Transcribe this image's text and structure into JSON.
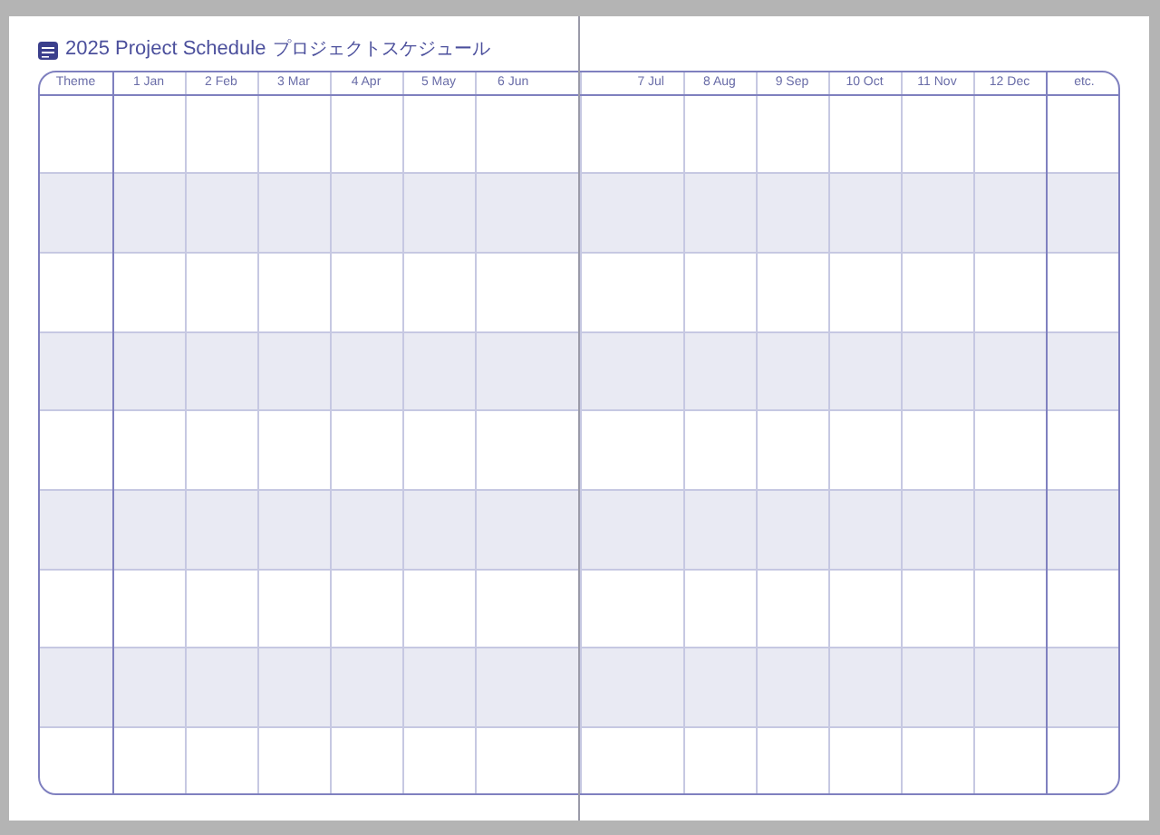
{
  "title": {
    "text": "2025 Project Schedule",
    "subtitle": "プロジェクトスケジュール"
  },
  "table": {
    "columns": [
      "Theme",
      "1 Jan",
      "2 Feb",
      "3 Mar",
      "4 Apr",
      "5 May",
      "6 Jun",
      "7 Jul",
      "8 Aug",
      "9 Sep",
      "10 Oct",
      "11 Nov",
      "12 Dec",
      "etc."
    ]
  }
}
